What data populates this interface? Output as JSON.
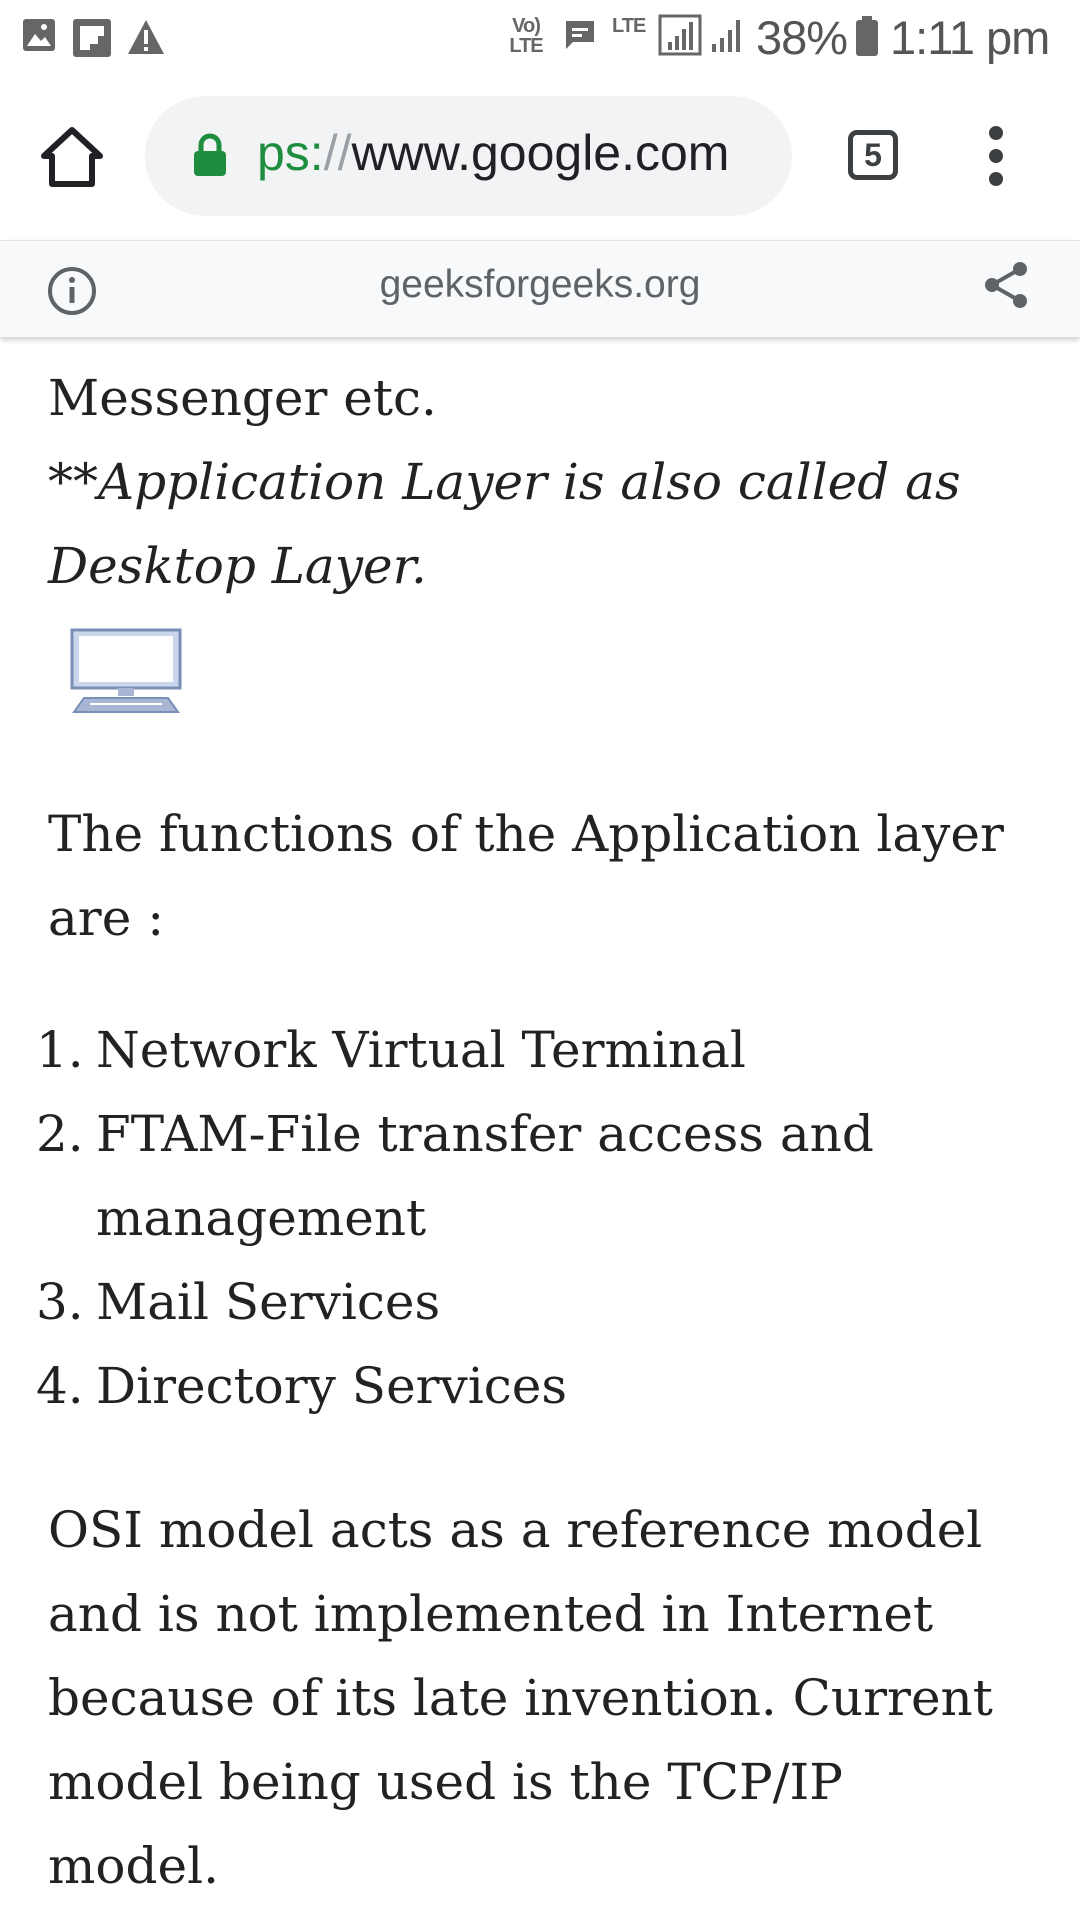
{
  "status_bar": {
    "network_label": "Vo) LTE",
    "data_label": "LTE",
    "battery": "38%",
    "time": "1:11 pm"
  },
  "toolbar": {
    "url_scheme_fragment": "ps:",
    "url_slashes": "//",
    "url_host": "www.google.com",
    "tab_count": "5"
  },
  "info_bar": {
    "domain": "geeksforgeeks.org"
  },
  "article": {
    "para1_first_line": "Messenger etc.",
    "para1_note_line1": "**Application Layer is also called as",
    "para1_note_line2": "Desktop Layer.",
    "functions_intro_line1": "The functions of the Application layer",
    "functions_intro_line2": "are :",
    "functions": [
      {
        "num": "1.",
        "text": "Network Virtual Terminal",
        "text2": ""
      },
      {
        "num": "2.",
        "text": "FTAM-File transfer access and",
        "text2": "management"
      },
      {
        "num": "3.",
        "text": "Mail Services",
        "text2": ""
      },
      {
        "num": "4.",
        "text": "Directory Services",
        "text2": ""
      }
    ],
    "osi_lines": [
      "OSI model acts as a reference model",
      "and is not implemented in Internet",
      "because of its late invention. Current",
      "model being used is the TCP/IP",
      "model."
    ]
  },
  "colors": {
    "lock_green": "#1e8e3e",
    "text": "#222222",
    "omnibox_bg": "#f1f3f4"
  }
}
